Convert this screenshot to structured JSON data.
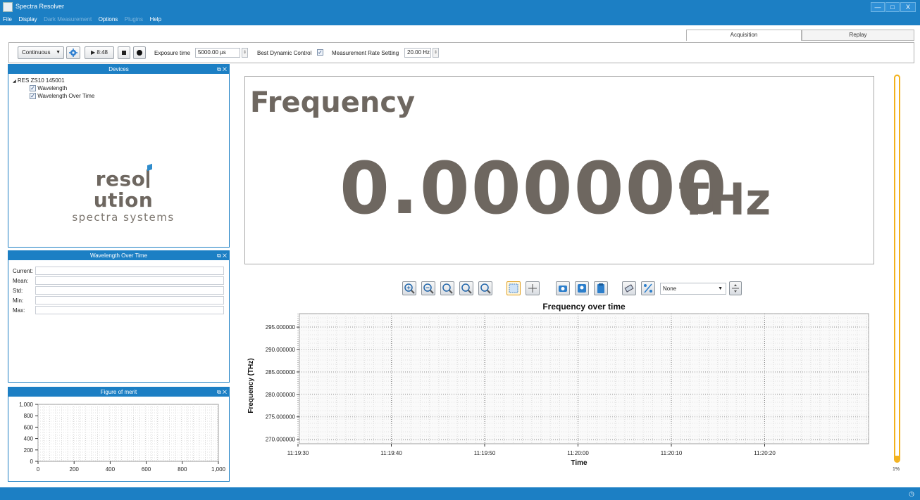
{
  "window": {
    "title": "Spectra Resolver",
    "minimize": "—",
    "maximize": "□",
    "close": "X"
  },
  "menu": [
    {
      "label": "File",
      "enabled": true
    },
    {
      "label": "Display",
      "enabled": true
    },
    {
      "label": "Dark Measurement",
      "enabled": false
    },
    {
      "label": "Options",
      "enabled": true
    },
    {
      "label": "Plugins",
      "enabled": false
    },
    {
      "label": "Help",
      "enabled": true
    }
  ],
  "tabs": {
    "acquisition": "Acquisition",
    "replay": "Replay"
  },
  "toolbar": {
    "mode": "Continuous",
    "play_time": "▶ 8:48",
    "exposure_label": "Exposure time",
    "exposure_value": "5000.00 µs",
    "best_dynamic_label": "Best Dynamic Control",
    "best_dynamic_checked": true,
    "rate_label": "Measurement Rate Setting",
    "rate_value": "20.00 Hz"
  },
  "devices_panel": {
    "title": "Devices",
    "device": "RES ZS10 145001",
    "items": [
      {
        "label": "Wavelength",
        "checked": true
      },
      {
        "label": "Wavelength Over Time",
        "checked": true
      }
    ],
    "logo_line1_a": "reso",
    "logo_line1_b": "ution",
    "logo_line2": "spectra systems"
  },
  "stats_panel": {
    "title": "Wavelength Over Time",
    "labels": [
      "Current:",
      "Mean:",
      "Std:",
      "Min:",
      "Max:"
    ]
  },
  "fom_panel": {
    "title": "Figure of merit",
    "y_ticks": [
      "1,000",
      "800",
      "600",
      "400",
      "200",
      "0"
    ],
    "x_ticks": [
      "0",
      "200",
      "400",
      "600",
      "800",
      "1,000"
    ]
  },
  "readout": {
    "label": "Frequency",
    "value": "0.000000",
    "unit": "THz"
  },
  "chart_toolbar": {
    "dropdown": "None"
  },
  "chart_data": {
    "type": "line",
    "title": "Frequency over time",
    "xlabel": "Time",
    "ylabel": "Frequency (THz)",
    "x_ticks": [
      "11:19:30",
      "11:19:40",
      "11:19:50",
      "11:20:00",
      "11:20:10",
      "11:20:20"
    ],
    "y_ticks": [
      "295.000000",
      "290.000000",
      "285.000000",
      "280.000000",
      "275.000000",
      "270.000000"
    ],
    "ylim": [
      269,
      298
    ],
    "grid": true,
    "series": []
  },
  "progress": {
    "value": 0.01,
    "label": "1%"
  }
}
